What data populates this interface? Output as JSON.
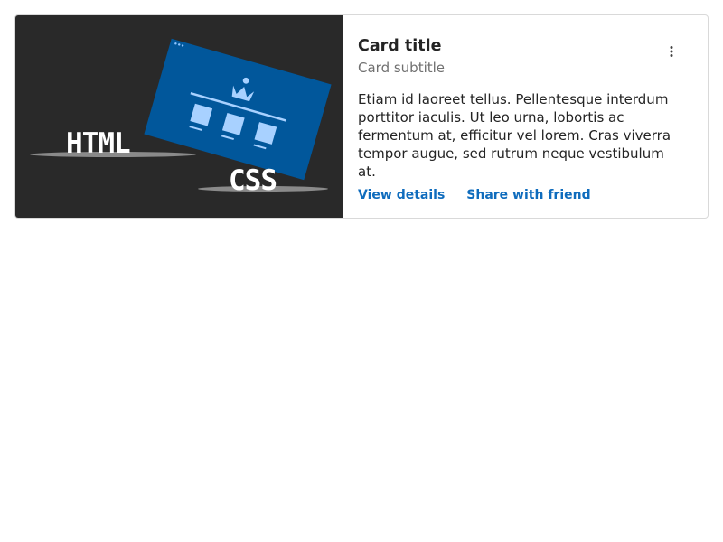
{
  "card": {
    "title": "Card title",
    "subtitle": "Card subtitle",
    "body": "Etiam id laoreet tellus. Pellentesque interdum porttitor iaculis. Ut leo urna, lobortis ac fermentum at, efficitur vel lorem. Cras viverra tempor augue, sed rutrum neque vestibulum at.",
    "actions": {
      "primary": "View details",
      "secondary": "Share with friend"
    },
    "more_icon": "more-vertical-icon",
    "image": {
      "text_html": "HTML",
      "text_css": "CSS"
    }
  },
  "colors": {
    "media_bg": "#292929",
    "browser_blue": "#01579b",
    "link": "#0f6cbd"
  }
}
